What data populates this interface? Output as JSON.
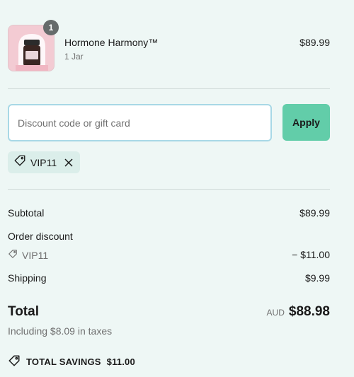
{
  "product": {
    "name": "Hormone Harmony™",
    "variant": "1 Jar",
    "price": "$89.99",
    "quantity": "1",
    "image_icon": "supplement-jar-thumbnail"
  },
  "discount": {
    "placeholder": "Discount code or gift card",
    "value": "",
    "apply_label": "Apply",
    "applied_code": "VIP11"
  },
  "summary": {
    "subtotal_label": "Subtotal",
    "subtotal_value": "$89.99",
    "order_discount_label": "Order discount",
    "discount_code": "VIP11",
    "discount_value": "− $11.00",
    "shipping_label": "Shipping",
    "shipping_value": "$9.99",
    "total_label": "Total",
    "currency": "AUD",
    "total_value": "$88.98",
    "taxes_note": "Including $8.09 in taxes",
    "savings_label": "TOTAL SAVINGS",
    "savings_value": "$11.00"
  },
  "colors": {
    "background": "#eef7f5",
    "accent": "#62cda9",
    "input_border": "#a8d8e6",
    "chip_bg": "#dbeeea"
  }
}
